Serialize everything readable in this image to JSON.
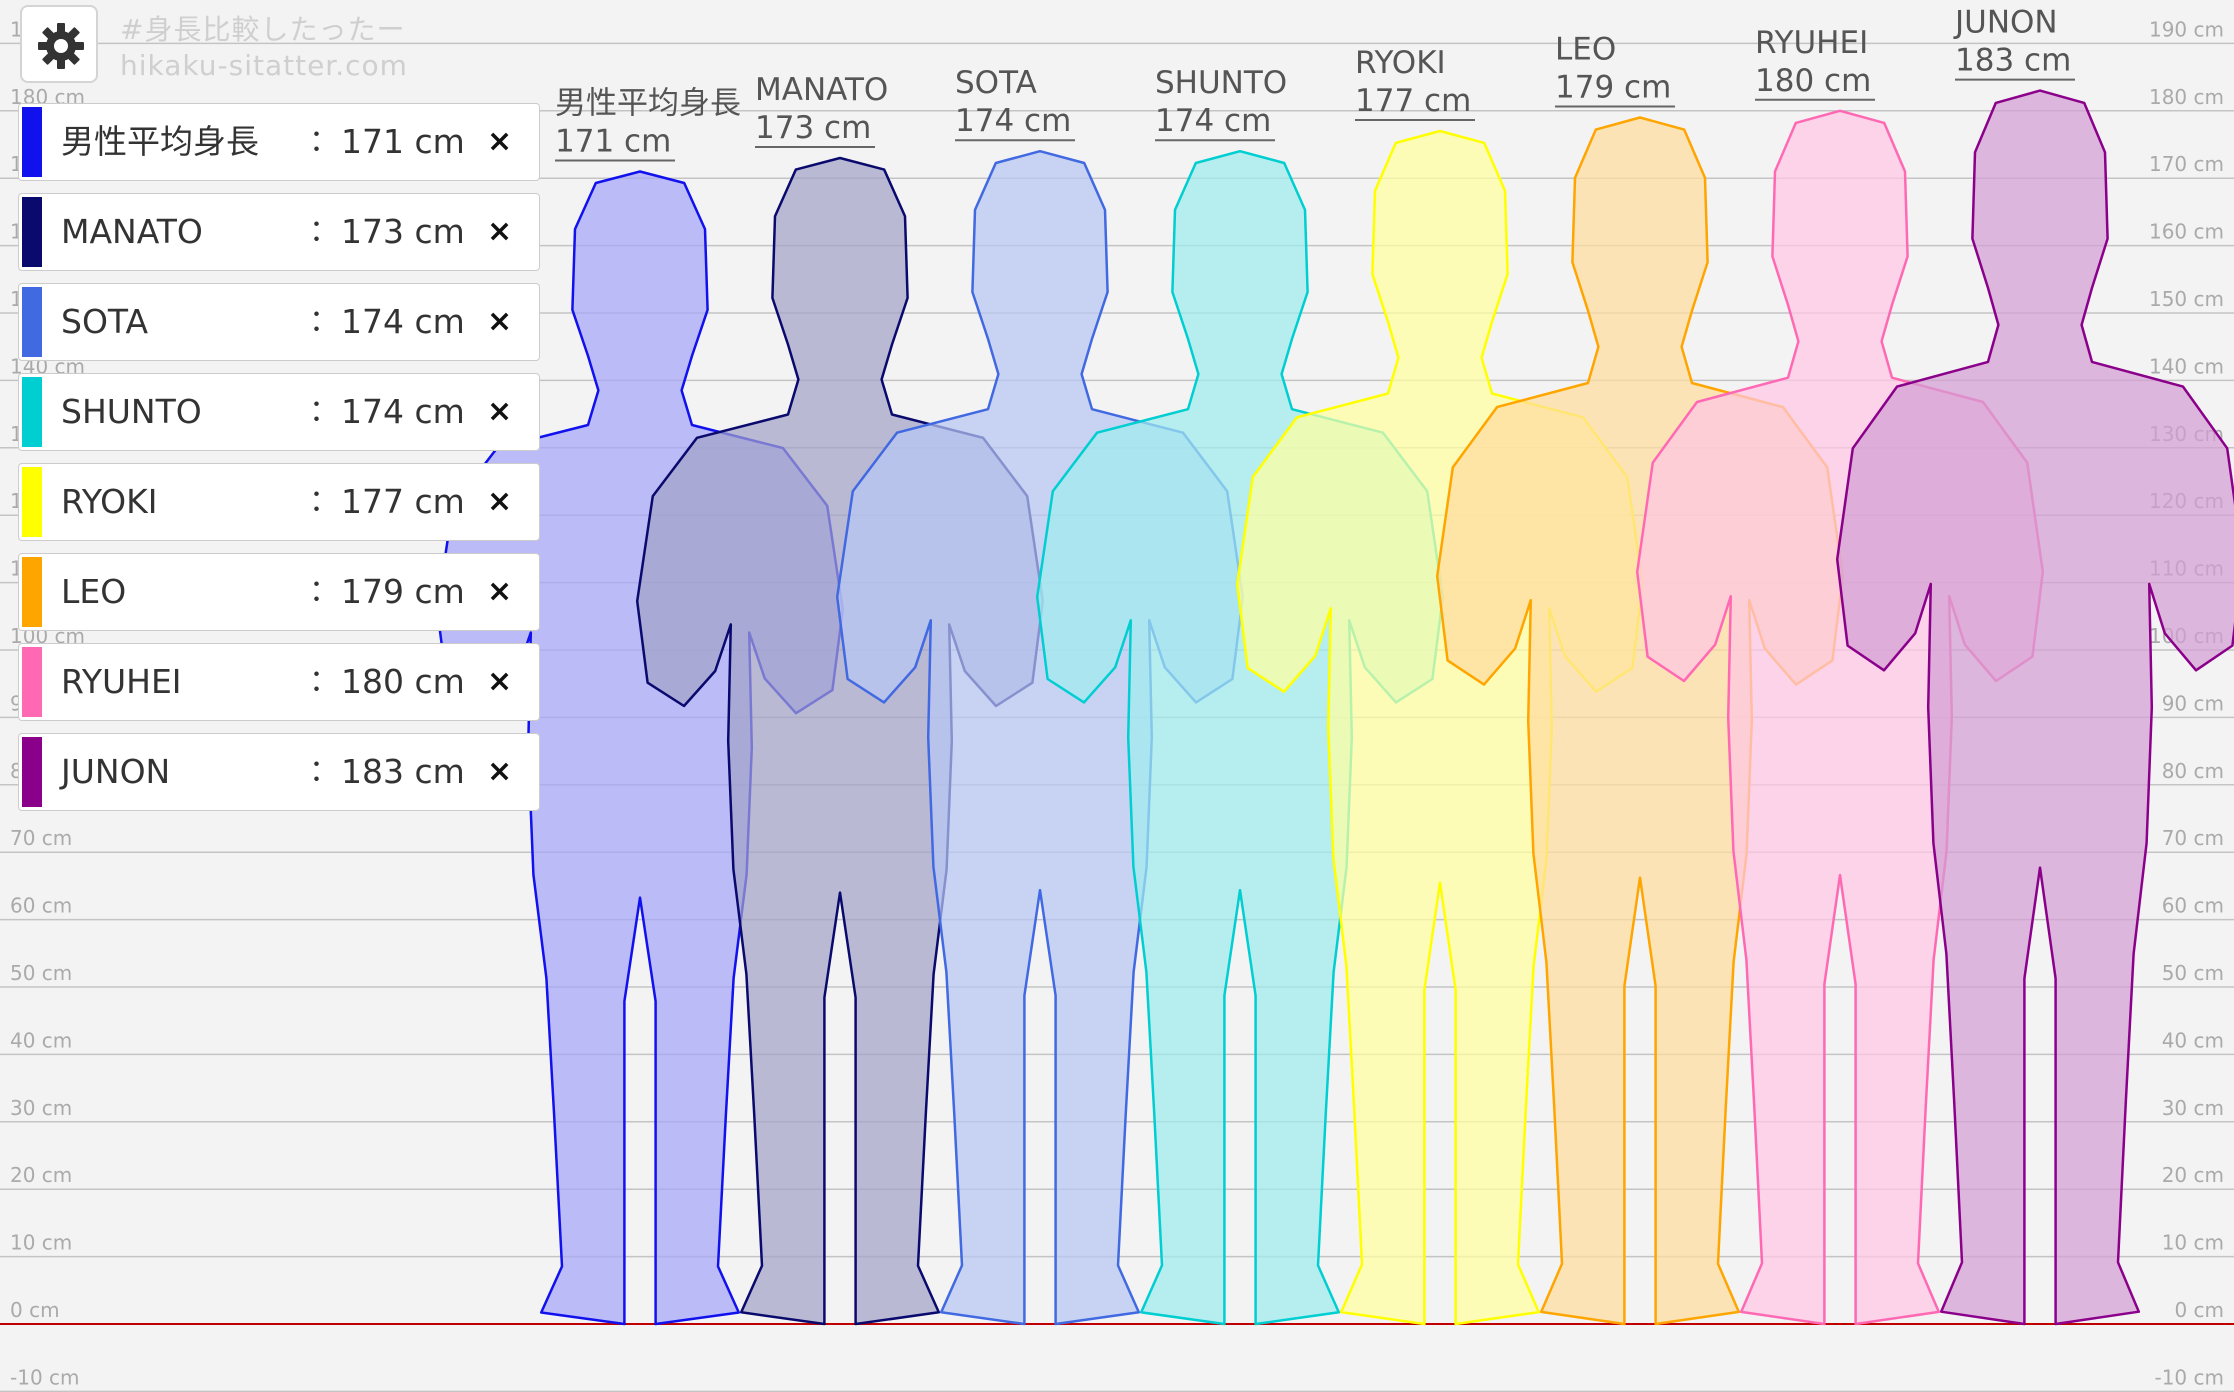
{
  "app": {
    "tagline": "#身長比較したったー",
    "site": "hikaku-sitatter.com"
  },
  "settings": {
    "icon": "gear-icon"
  },
  "scale": {
    "unit": "cm",
    "min": -10,
    "max": 190,
    "step": 10,
    "baseline_color": "#c00000"
  },
  "people": [
    {
      "name": "男性平均身長",
      "height": 171,
      "height_label": "171 cm",
      "color": "#1111ee"
    },
    {
      "name": "MANATO",
      "height": 173,
      "height_label": "173 cm",
      "color": "#0a0a6e"
    },
    {
      "name": "SOTA",
      "height": 174,
      "height_label": "174 cm",
      "color": "#4169e1"
    },
    {
      "name": "SHUNTO",
      "height": 174,
      "height_label": "174 cm",
      "color": "#00ced1"
    },
    {
      "name": "RYOKI",
      "height": 177,
      "height_label": "177 cm",
      "color": "#ffff00"
    },
    {
      "name": "LEO",
      "height": 179,
      "height_label": "179 cm",
      "color": "#ffa500"
    },
    {
      "name": "RYUHEI",
      "height": 180,
      "height_label": "180 cm",
      "color": "#ff69b4"
    },
    {
      "name": "JUNON",
      "height": 183,
      "height_label": "183 cm",
      "color": "#8b008b"
    }
  ],
  "legend": {
    "colon": "：",
    "remove_symbol": "×"
  }
}
